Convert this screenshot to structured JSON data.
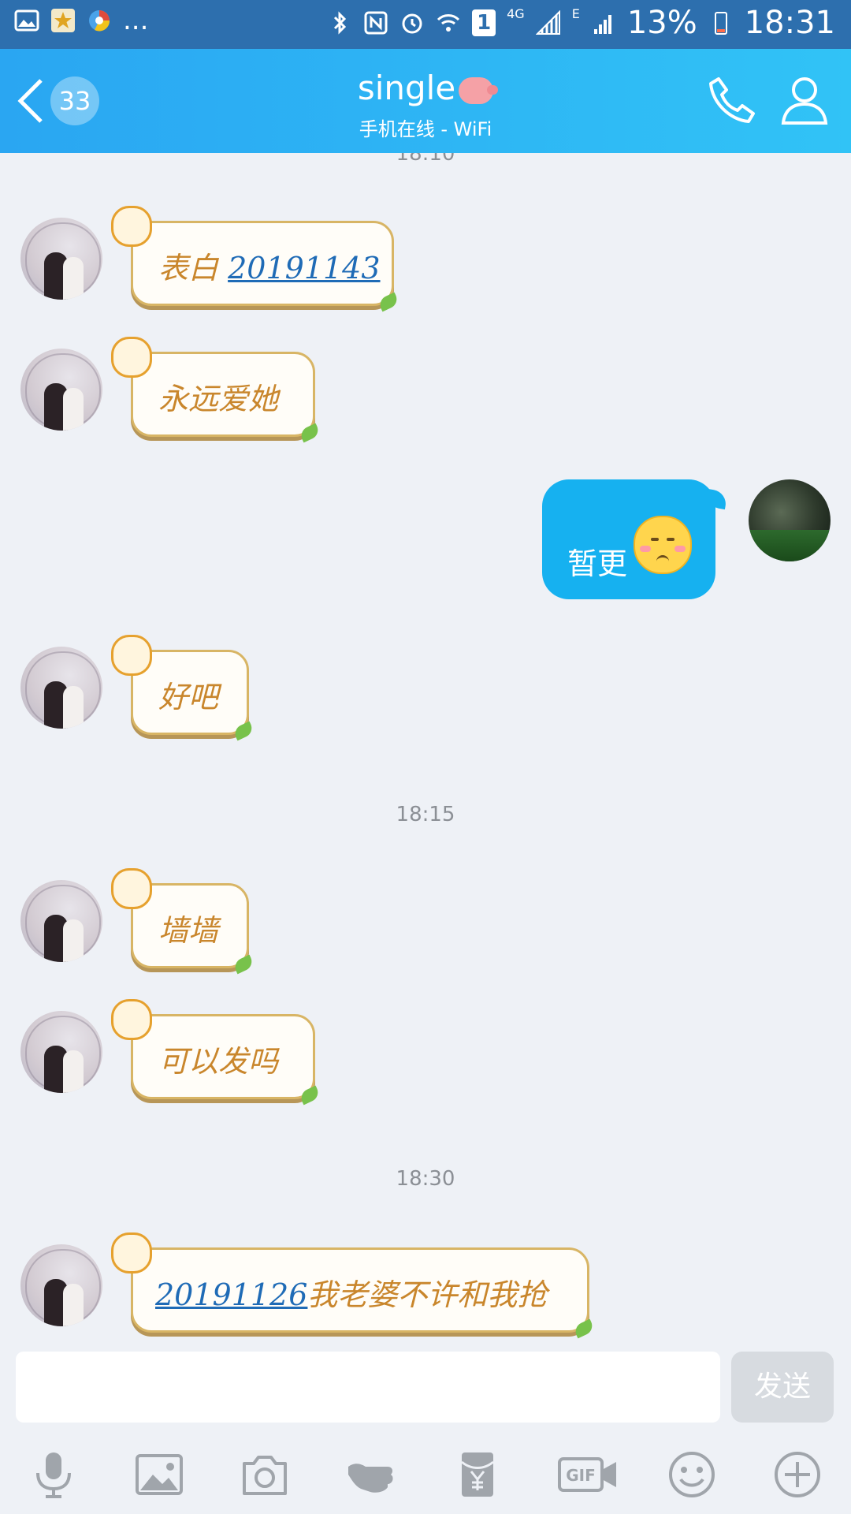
{
  "status_bar": {
    "battery": "13%",
    "time": "18:31",
    "signal_4g": "4G",
    "signal_e": "E",
    "sim_slot": "1",
    "overflow": "..."
  },
  "header": {
    "back_unread": "33",
    "title": "single",
    "subtitle": "手机在线 - WiFi"
  },
  "chat": {
    "top_time_partial": "18:10",
    "messages": [
      {
        "from": "other",
        "prefix": "表白",
        "link": "20191143",
        "suffix": ""
      },
      {
        "from": "other",
        "text": "永远爱她"
      },
      {
        "from": "me",
        "text": "暂更",
        "emoji": "pleading-face"
      },
      {
        "from": "other",
        "text": "好吧"
      },
      {
        "from": "time",
        "text": "18:15"
      },
      {
        "from": "other",
        "text": "墙墙"
      },
      {
        "from": "other",
        "text": "可以发吗"
      },
      {
        "from": "time",
        "text": "18:30"
      },
      {
        "from": "other",
        "link": "20191126",
        "suffix": "我老婆不许和我抢"
      }
    ]
  },
  "input": {
    "value": "",
    "placeholder": "",
    "send_label": "发送"
  },
  "toolbar": [
    "mic-icon",
    "image-icon",
    "camera-icon",
    "poke-icon",
    "red-packet-icon",
    "gif-icon",
    "emoji-icon",
    "plus-icon"
  ],
  "colors": {
    "header_start": "#2aa6f2",
    "header_end": "#31c3f6",
    "my_bubble": "#16b1f0",
    "bubble_text": "#c9862c",
    "link": "#1f6bb6"
  }
}
